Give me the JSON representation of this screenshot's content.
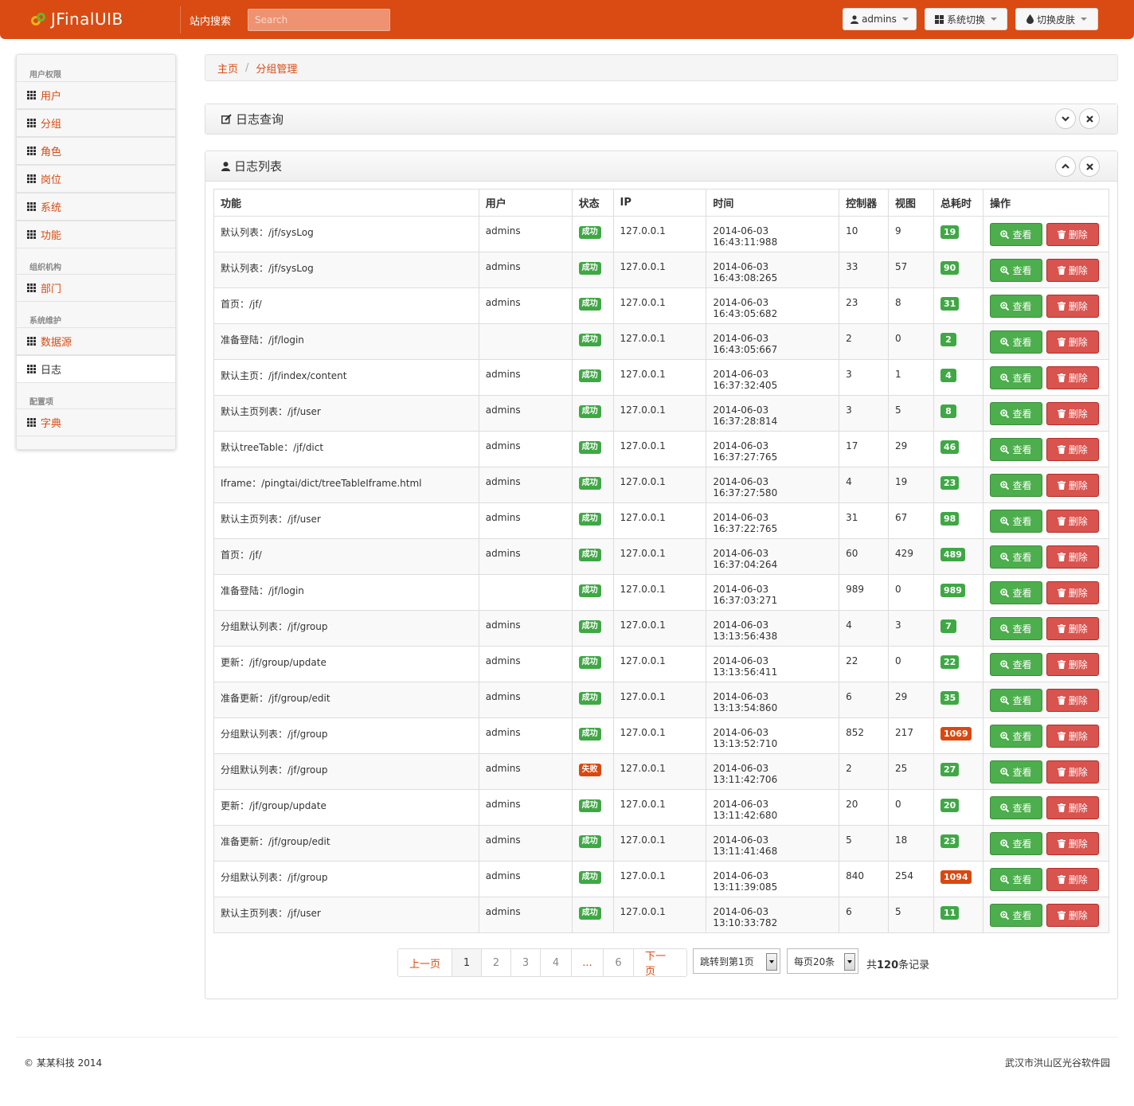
{
  "brand": {
    "name": "JFinalUIB"
  },
  "topnav": {
    "search_label": "站内搜索",
    "search_placeholder": "Search",
    "user_button": "admins",
    "system_button": "系统切换",
    "skin_button": "切换皮肤"
  },
  "sidebar": {
    "groups": [
      {
        "header": "用户权限",
        "items": [
          "用户",
          "分组",
          "角色",
          "岗位",
          "系统",
          "功能"
        ]
      },
      {
        "header": "组织机构",
        "items": [
          "部门"
        ]
      },
      {
        "header": "系统维护",
        "items": [
          "数据源",
          "日志"
        ]
      },
      {
        "header": "配置项",
        "items": [
          "字典"
        ]
      }
    ],
    "active_item": "日志"
  },
  "breadcrumb": {
    "home": "主页",
    "current": "分组管理"
  },
  "query_panel": {
    "title": "日志查询"
  },
  "list_panel": {
    "title": "日志列表"
  },
  "table": {
    "headers": [
      "功能",
      "用户",
      "状态",
      "IP",
      "时间",
      "控制器",
      "视图",
      "总耗时",
      "操作"
    ],
    "view_label": "查看",
    "delete_label": "删除",
    "rows": [
      {
        "func": "默认列表：/jf/sysLog",
        "user": "admins",
        "status": "成功",
        "status_type": "ok",
        "ip": "127.0.0.1",
        "time": "2014-06-03 16:43:11:988",
        "controller": "10",
        "view": "9",
        "total": "19",
        "total_type": "g"
      },
      {
        "func": "默认列表：/jf/sysLog",
        "user": "admins",
        "status": "成功",
        "status_type": "ok",
        "ip": "127.0.0.1",
        "time": "2014-06-03 16:43:08:265",
        "controller": "33",
        "view": "57",
        "total": "90",
        "total_type": "g"
      },
      {
        "func": "首页：/jf/",
        "user": "admins",
        "status": "成功",
        "status_type": "ok",
        "ip": "127.0.0.1",
        "time": "2014-06-03 16:43:05:682",
        "controller": "23",
        "view": "8",
        "total": "31",
        "total_type": "g"
      },
      {
        "func": "准备登陆：/jf/login",
        "user": "",
        "status": "成功",
        "status_type": "ok",
        "ip": "127.0.0.1",
        "time": "2014-06-03 16:43:05:667",
        "controller": "2",
        "view": "0",
        "total": "2",
        "total_type": "g"
      },
      {
        "func": "默认主页：/jf/index/content",
        "user": "admins",
        "status": "成功",
        "status_type": "ok",
        "ip": "127.0.0.1",
        "time": "2014-06-03 16:37:32:405",
        "controller": "3",
        "view": "1",
        "total": "4",
        "total_type": "g"
      },
      {
        "func": "默认主页列表：/jf/user",
        "user": "admins",
        "status": "成功",
        "status_type": "ok",
        "ip": "127.0.0.1",
        "time": "2014-06-03 16:37:28:814",
        "controller": "3",
        "view": "5",
        "total": "8",
        "total_type": "g"
      },
      {
        "func": "默认treeTable：/jf/dict",
        "user": "admins",
        "status": "成功",
        "status_type": "ok",
        "ip": "127.0.0.1",
        "time": "2014-06-03 16:37:27:765",
        "controller": "17",
        "view": "29",
        "total": "46",
        "total_type": "g"
      },
      {
        "func": "Iframe：/pingtai/dict/treeTableIframe.html",
        "user": "admins",
        "status": "成功",
        "status_type": "ok",
        "ip": "127.0.0.1",
        "time": "2014-06-03 16:37:27:580",
        "controller": "4",
        "view": "19",
        "total": "23",
        "total_type": "g"
      },
      {
        "func": "默认主页列表：/jf/user",
        "user": "admins",
        "status": "成功",
        "status_type": "ok",
        "ip": "127.0.0.1",
        "time": "2014-06-03 16:37:22:765",
        "controller": "31",
        "view": "67",
        "total": "98",
        "total_type": "g"
      },
      {
        "func": "首页：/jf/",
        "user": "admins",
        "status": "成功",
        "status_type": "ok",
        "ip": "127.0.0.1",
        "time": "2014-06-03 16:37:04:264",
        "controller": "60",
        "view": "429",
        "total": "489",
        "total_type": "g"
      },
      {
        "func": "准备登陆：/jf/login",
        "user": "",
        "status": "成功",
        "status_type": "ok",
        "ip": "127.0.0.1",
        "time": "2014-06-03 16:37:03:271",
        "controller": "989",
        "view": "0",
        "total": "989",
        "total_type": "g"
      },
      {
        "func": "分组默认列表：/jf/group",
        "user": "admins",
        "status": "成功",
        "status_type": "ok",
        "ip": "127.0.0.1",
        "time": "2014-06-03 13:13:56:438",
        "controller": "4",
        "view": "3",
        "total": "7",
        "total_type": "g"
      },
      {
        "func": "更新：/jf/group/update",
        "user": "admins",
        "status": "成功",
        "status_type": "ok",
        "ip": "127.0.0.1",
        "time": "2014-06-03 13:13:56:411",
        "controller": "22",
        "view": "0",
        "total": "22",
        "total_type": "g"
      },
      {
        "func": "准备更新：/jf/group/edit",
        "user": "admins",
        "status": "成功",
        "status_type": "ok",
        "ip": "127.0.0.1",
        "time": "2014-06-03 13:13:54:860",
        "controller": "6",
        "view": "29",
        "total": "35",
        "total_type": "g"
      },
      {
        "func": "分组默认列表：/jf/group",
        "user": "admins",
        "status": "成功",
        "status_type": "ok",
        "ip": "127.0.0.1",
        "time": "2014-06-03 13:13:52:710",
        "controller": "852",
        "view": "217",
        "total": "1069",
        "total_type": "r"
      },
      {
        "func": "分组默认列表：/jf/group",
        "user": "admins",
        "status": "失败",
        "status_type": "fail",
        "ip": "127.0.0.1",
        "time": "2014-06-03 13:11:42:706",
        "controller": "2",
        "view": "25",
        "total": "27",
        "total_type": "g"
      },
      {
        "func": "更新：/jf/group/update",
        "user": "admins",
        "status": "成功",
        "status_type": "ok",
        "ip": "127.0.0.1",
        "time": "2014-06-03 13:11:42:680",
        "controller": "20",
        "view": "0",
        "total": "20",
        "total_type": "g"
      },
      {
        "func": "准备更新：/jf/group/edit",
        "user": "admins",
        "status": "成功",
        "status_type": "ok",
        "ip": "127.0.0.1",
        "time": "2014-06-03 13:11:41:468",
        "controller": "5",
        "view": "18",
        "total": "23",
        "total_type": "g"
      },
      {
        "func": "分组默认列表：/jf/group",
        "user": "admins",
        "status": "成功",
        "status_type": "ok",
        "ip": "127.0.0.1",
        "time": "2014-06-03 13:11:39:085",
        "controller": "840",
        "view": "254",
        "total": "1094",
        "total_type": "r"
      },
      {
        "func": "默认主页列表：/jf/user",
        "user": "admins",
        "status": "成功",
        "status_type": "ok",
        "ip": "127.0.0.1",
        "time": "2014-06-03 13:10:33:782",
        "controller": "6",
        "view": "5",
        "total": "11",
        "total_type": "g"
      }
    ]
  },
  "pagination": {
    "prev": "上一页",
    "pages": [
      "1",
      "2",
      "3",
      "4",
      "...",
      "6"
    ],
    "current": "1",
    "next": "下一页",
    "jump_select": "跳转到第1页",
    "size_select": "每页20条",
    "total_prefix": "共",
    "total_count": "120",
    "total_suffix": "条记录"
  },
  "footer": {
    "left": "© 某某科技 2014",
    "right": "武汉市洪山区光谷软件园"
  },
  "colors": {
    "brand": "#d94b12",
    "success": "#3fa845",
    "danger": "#d9534f"
  },
  "icons": {
    "query_panel": "edit-icon",
    "list_panel": "user-icon",
    "view_button": "zoom-in-icon",
    "delete_button": "trash-icon"
  }
}
